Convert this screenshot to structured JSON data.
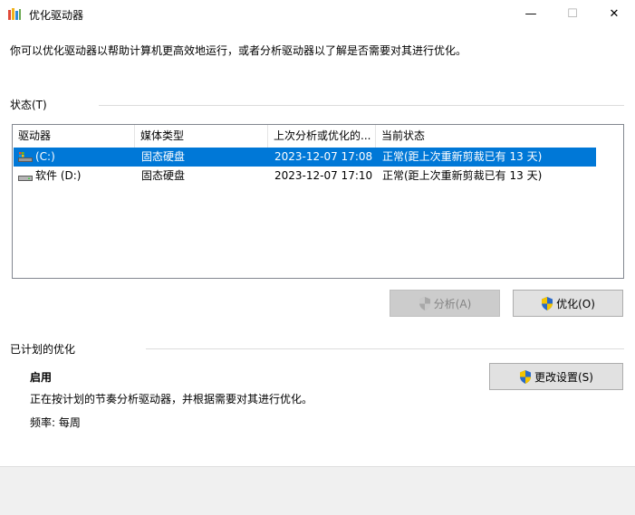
{
  "window": {
    "title": "优化驱动器",
    "minimize": "—",
    "maximize": "☐",
    "close": "✕"
  },
  "description": "你可以优化驱动器以帮助计算机更高效地运行，或者分析驱动器以了解是否需要对其进行优化。",
  "status_group": {
    "label": "状态(T)",
    "columns": [
      "驱动器",
      "媒体类型",
      "上次分析或优化的...",
      "当前状态"
    ],
    "rows": [
      {
        "drive": "(C:)",
        "media": "固态硬盘",
        "last": "2023-12-07 17:08",
        "state": "正常(距上次重新剪裁已有 13 天)",
        "selected": true
      },
      {
        "drive": "软件 (D:)",
        "media": "固态硬盘",
        "last": "2023-12-07 17:10",
        "state": "正常(距上次重新剪裁已有 13 天)",
        "selected": false
      }
    ],
    "analyze_label": "分析(A)",
    "optimize_label": "优化(O)"
  },
  "schedule_group": {
    "label": "已计划的优化",
    "status": "启用",
    "description": "正在按计划的节奏分析驱动器，并根据需要对其进行优化。",
    "frequency": "频率: 每周",
    "change_label": "更改设置(S)"
  },
  "colors": {
    "selection": "#0078d7",
    "button": "#e1e1e1",
    "disabled_button": "#cccccc"
  }
}
